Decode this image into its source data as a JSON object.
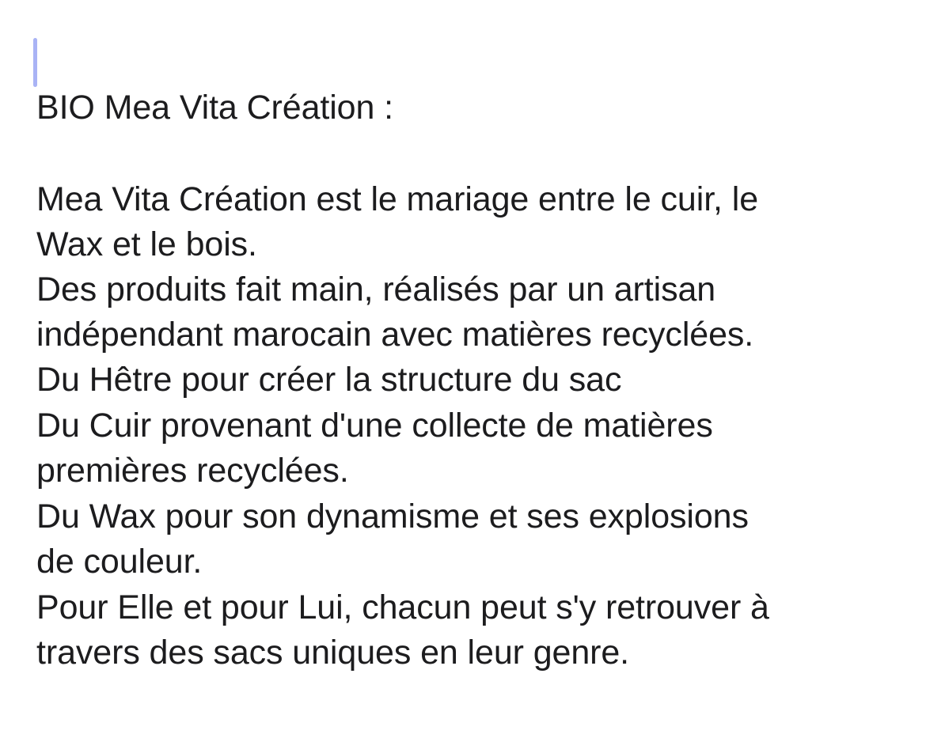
{
  "note": {
    "title": "BIO Mea Vita Création :",
    "lines": [
      "Mea Vita Création est le mariage entre le cuir, le",
      "Wax et le bois.",
      "Des produits fait main, réalisés par un artisan",
      "indépendant marocain avec matières recyclées.",
      "Du Hêtre pour créer la structure du sac",
      "Du Cuir provenant d'une collecte de matières",
      "premières recyclées.",
      "Du Wax pour son dynamisme et ses explosions",
      "de couleur.",
      "Pour Elle et pour Lui, chacun peut s'y retrouver à",
      "travers des sacs uniques en leur genre."
    ]
  }
}
